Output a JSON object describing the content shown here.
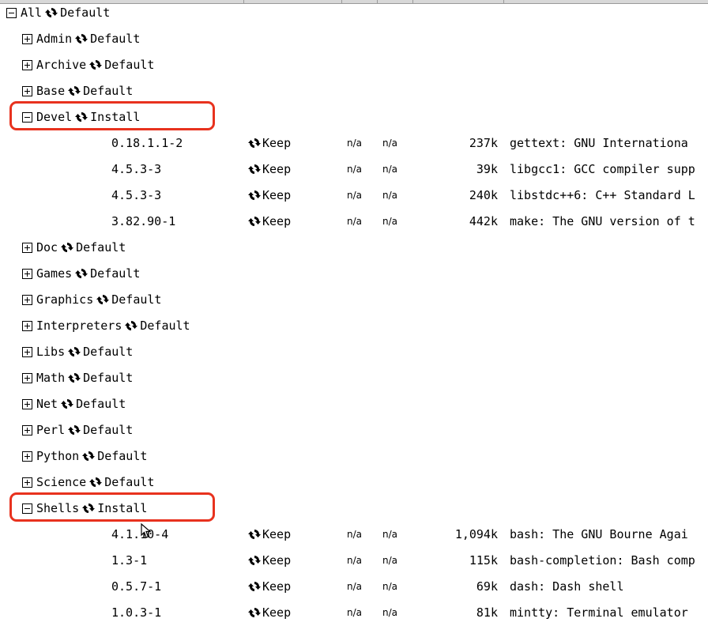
{
  "window": {
    "title": ""
  },
  "tree": {
    "root": {
      "name": "All",
      "action": "Default",
      "expanded": true
    },
    "categories": [
      {
        "name": "Admin",
        "action": "Default",
        "expanded": false,
        "highlighted": false,
        "packages": []
      },
      {
        "name": "Archive",
        "action": "Default",
        "expanded": false,
        "highlighted": false,
        "packages": []
      },
      {
        "name": "Base",
        "action": "Default",
        "expanded": false,
        "highlighted": false,
        "packages": []
      },
      {
        "name": "Devel",
        "action": "Install",
        "expanded": true,
        "highlighted": true,
        "packages": [
          {
            "version": "0.18.1.1-2",
            "action": "Keep",
            "src": "n/a",
            "bin": "n/a",
            "size": "237k",
            "description": "gettext: GNU Internationa"
          },
          {
            "version": "4.5.3-3",
            "action": "Keep",
            "src": "n/a",
            "bin": "n/a",
            "size": "39k",
            "description": "libgcc1: GCC compiler supp"
          },
          {
            "version": "4.5.3-3",
            "action": "Keep",
            "src": "n/a",
            "bin": "n/a",
            "size": "240k",
            "description": "libstdc++6: C++ Standard L"
          },
          {
            "version": "3.82.90-1",
            "action": "Keep",
            "src": "n/a",
            "bin": "n/a",
            "size": "442k",
            "description": "make: The GNU version of t"
          }
        ]
      },
      {
        "name": "Doc",
        "action": "Default",
        "expanded": false,
        "highlighted": false,
        "packages": []
      },
      {
        "name": "Games",
        "action": "Default",
        "expanded": false,
        "highlighted": false,
        "packages": []
      },
      {
        "name": "Graphics",
        "action": "Default",
        "expanded": false,
        "highlighted": false,
        "packages": []
      },
      {
        "name": "Interpreters",
        "action": "Default",
        "expanded": false,
        "highlighted": false,
        "packages": []
      },
      {
        "name": "Libs",
        "action": "Default",
        "expanded": false,
        "highlighted": false,
        "packages": []
      },
      {
        "name": "Math",
        "action": "Default",
        "expanded": false,
        "highlighted": false,
        "packages": []
      },
      {
        "name": "Net",
        "action": "Default",
        "expanded": false,
        "highlighted": false,
        "packages": []
      },
      {
        "name": "Perl",
        "action": "Default",
        "expanded": false,
        "highlighted": false,
        "packages": []
      },
      {
        "name": "Python",
        "action": "Default",
        "expanded": false,
        "highlighted": false,
        "packages": []
      },
      {
        "name": "Science",
        "action": "Default",
        "expanded": false,
        "highlighted": false,
        "packages": []
      },
      {
        "name": "Shells",
        "action": "Install",
        "expanded": true,
        "highlighted": true,
        "packages": [
          {
            "version": "4.1.10-4",
            "action": "Keep",
            "src": "n/a",
            "bin": "n/a",
            "size": "1,094k",
            "description": "bash: The GNU Bourne Agai"
          },
          {
            "version": "1.3-1",
            "action": "Keep",
            "src": "n/a",
            "bin": "n/a",
            "size": "115k",
            "description": "bash-completion: Bash comp"
          },
          {
            "version": "0.5.7-1",
            "action": "Keep",
            "src": "n/a",
            "bin": "n/a",
            "size": "69k",
            "description": "dash: Dash shell"
          },
          {
            "version": "1.0.3-1",
            "action": "Keep",
            "src": "n/a",
            "bin": "n/a",
            "size": "81k",
            "description": "mintty: Terminal emulator"
          }
        ]
      }
    ]
  },
  "colors": {
    "highlight": "#e8321e"
  },
  "icons": {
    "expand": "plus-box-icon",
    "collapse": "minus-box-icon",
    "action": "cycle-icon"
  }
}
